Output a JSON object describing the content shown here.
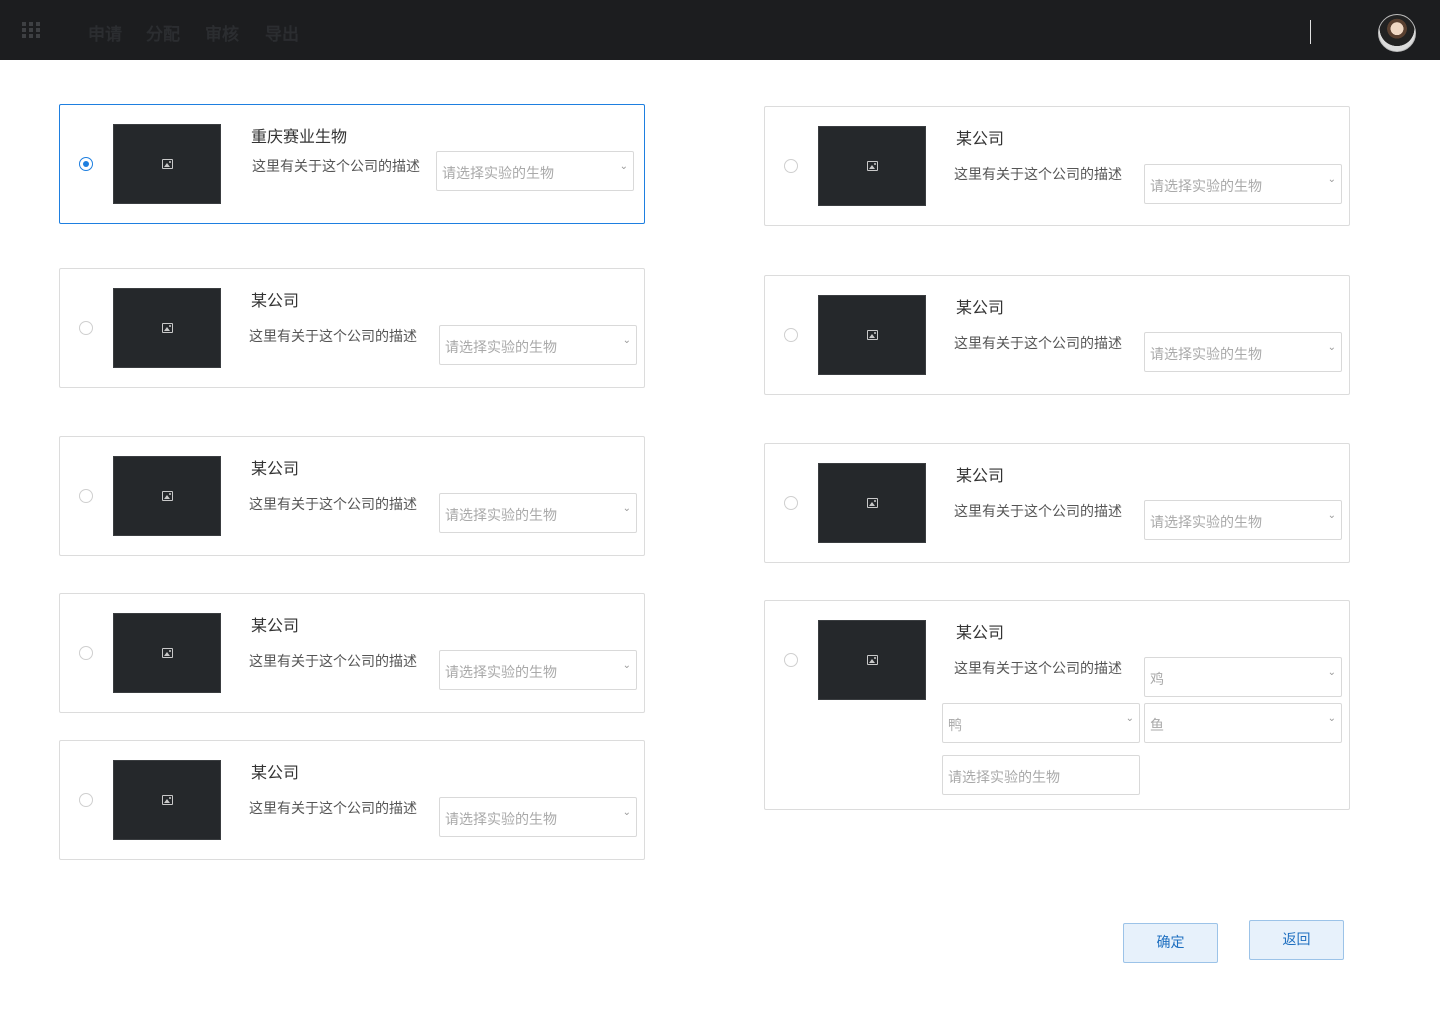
{
  "nav": {
    "items": [
      "申请",
      "分配",
      "审核",
      "导出"
    ]
  },
  "cards": {
    "c0": {
      "title": "重庆赛业生物",
      "desc": "这里有关于这个公司的描述",
      "placeholder": "请选择实验的生物",
      "selected": true
    },
    "c1": {
      "title": "某公司",
      "desc": "这里有关于这个公司的描述",
      "placeholder": "请选择实验的生物",
      "selected": false
    },
    "c2": {
      "title": "某公司",
      "desc": "这里有关于这个公司的描述",
      "placeholder": "请选择实验的生物",
      "selected": false
    },
    "c3": {
      "title": "某公司",
      "desc": "这里有关于这个公司的描述",
      "placeholder": "请选择实验的生物",
      "selected": false
    },
    "c4": {
      "title": "某公司",
      "desc": "这里有关于这个公司的描述",
      "placeholder": "请选择实验的生物",
      "selected": false
    },
    "c5": {
      "title": "某公司",
      "desc": "这里有关于这个公司的描述",
      "placeholder": "请选择实验的生物",
      "selected": false
    },
    "c6": {
      "title": "某公司",
      "desc": "这里有关于这个公司的描述",
      "placeholder": "请选择实验的生物",
      "selected": false
    },
    "c7": {
      "title": "某公司",
      "desc": "这里有关于这个公司的描述",
      "placeholder": "请选择实验的生物",
      "selected": false
    },
    "c8": {
      "title": "某公司",
      "desc": "这里有关于这个公司的描述",
      "selected": false,
      "selected_organisms": [
        "鸡",
        "鸭",
        "鱼"
      ],
      "input_placeholder": "请选择实验的生物"
    }
  },
  "actions": {
    "confirm": "确定",
    "back": "返回"
  },
  "colors": {
    "topbar": "#1c1d1f",
    "accent": "#1e7fe0",
    "thumbnail": "#25282b"
  }
}
